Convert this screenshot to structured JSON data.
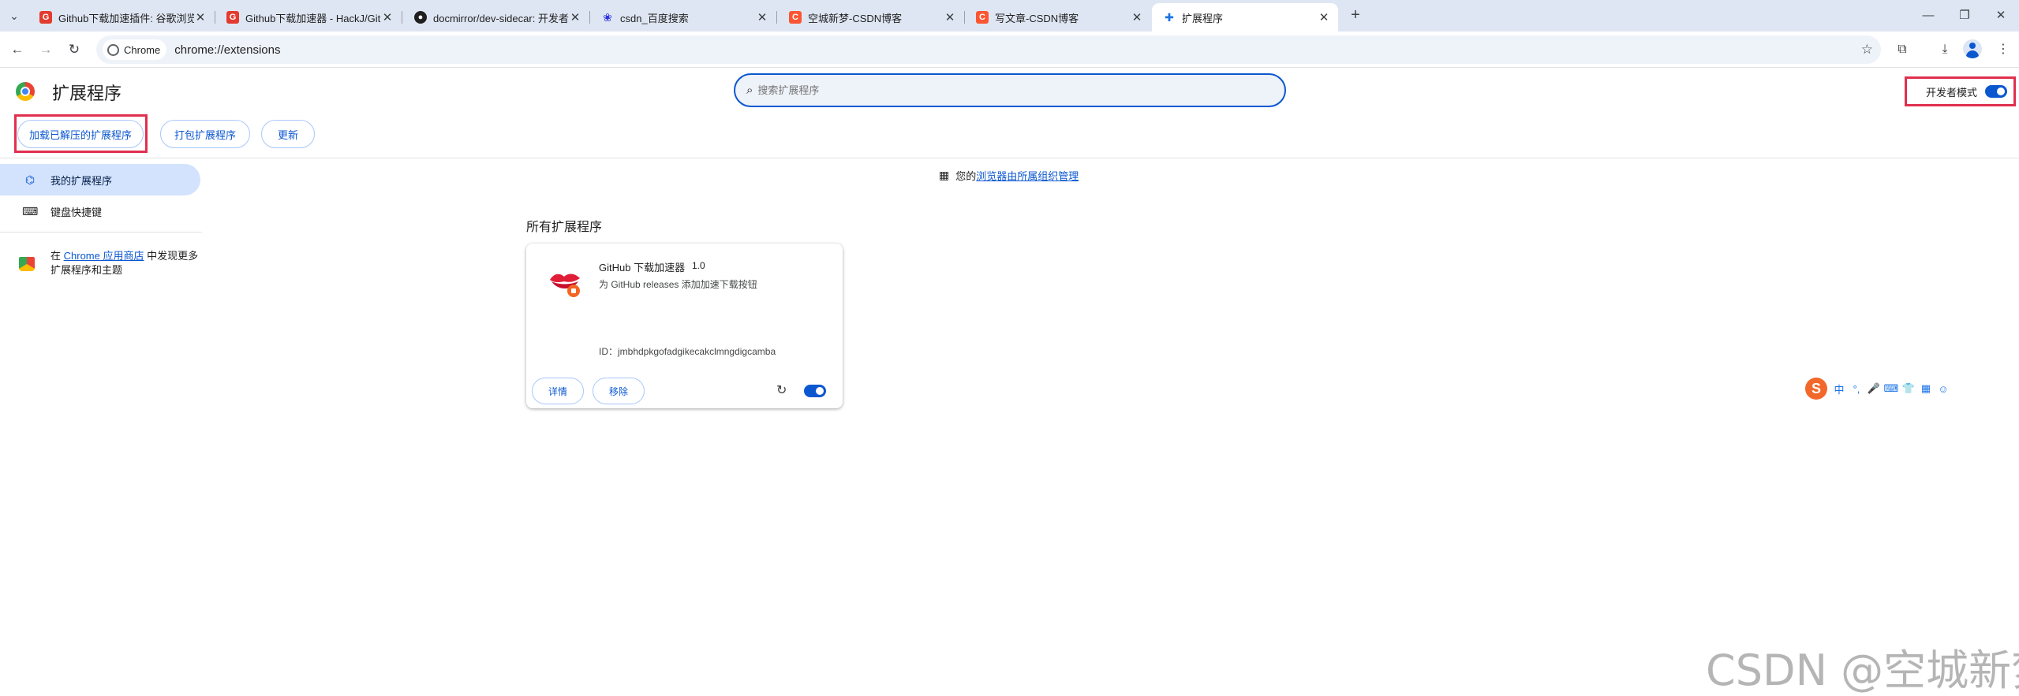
{
  "browser": {
    "tabs": [
      {
        "title": "Github下载加速插件: 谷歌浏览器",
        "favicon": "csdn-red-icon",
        "favicon_color": "#e33b2e",
        "active": false
      },
      {
        "title": "Github下载加速器 - HackJ/Git",
        "favicon": "csdn-red-icon",
        "favicon_color": "#e33b2e",
        "active": false
      },
      {
        "title": "docmirror/dev-sidecar: 开发者",
        "favicon": "github-icon",
        "favicon_color": "#1f1f1f",
        "active": false
      },
      {
        "title": "csdn_百度搜索",
        "favicon": "baidu-paw-icon",
        "favicon_color": "#2932e1",
        "active": false
      },
      {
        "title": "空城新梦-CSDN博客",
        "favicon": "csdn-c-icon",
        "favicon_color": "#fc5531",
        "active": false
      },
      {
        "title": "写文章-CSDN博客",
        "favicon": "csdn-c-icon",
        "favicon_color": "#fc5531",
        "active": false
      },
      {
        "title": "扩展程序",
        "favicon": "puzzle-icon",
        "favicon_color": "#1a73e8",
        "active": true
      }
    ],
    "new_tab": "+",
    "site_chip": "Chrome",
    "url": "chrome://extensions"
  },
  "page": {
    "title": "扩展程序",
    "search_placeholder": "搜索扩展程序",
    "dev_mode_label": "开发者模式",
    "dev_mode_on": true,
    "buttons": {
      "load_unpacked": "加载已解压的扩展程序",
      "pack": "打包扩展程序",
      "update": "更新"
    },
    "managed_prefix": "您的",
    "managed_link": "浏览器由所属组织管理",
    "section_title": "所有扩展程序"
  },
  "sidebar": {
    "items": [
      {
        "label": "我的扩展程序",
        "icon": "extensions-icon",
        "active": true
      },
      {
        "label": "键盘快捷键",
        "icon": "keyboard-icon",
        "active": false
      }
    ],
    "webstore_before": "在 ",
    "webstore_link": "Chrome 应用商店",
    "webstore_after": " 中发现更多扩展程序和主题"
  },
  "extension": {
    "name": "GitHub 下载加速器",
    "version": "1.0",
    "description": "为 GitHub releases 添加加速下载按钮",
    "id": "ID：jmbhdpkgofadgikecakclmngdigcamba",
    "details_label": "详情",
    "remove_label": "移除",
    "enabled": true,
    "icon": "lips-icon"
  },
  "ime_toolbar": {
    "logo": "S",
    "items": [
      "中",
      "°,",
      "🎤",
      "⌨",
      "👕",
      "▦",
      "☺"
    ]
  },
  "watermark": "CSDN @空城新梦",
  "colors": {
    "accent": "#0b57d0",
    "highlight_box": "#e0304e",
    "tabstrip_bg": "#dfe6f3"
  }
}
